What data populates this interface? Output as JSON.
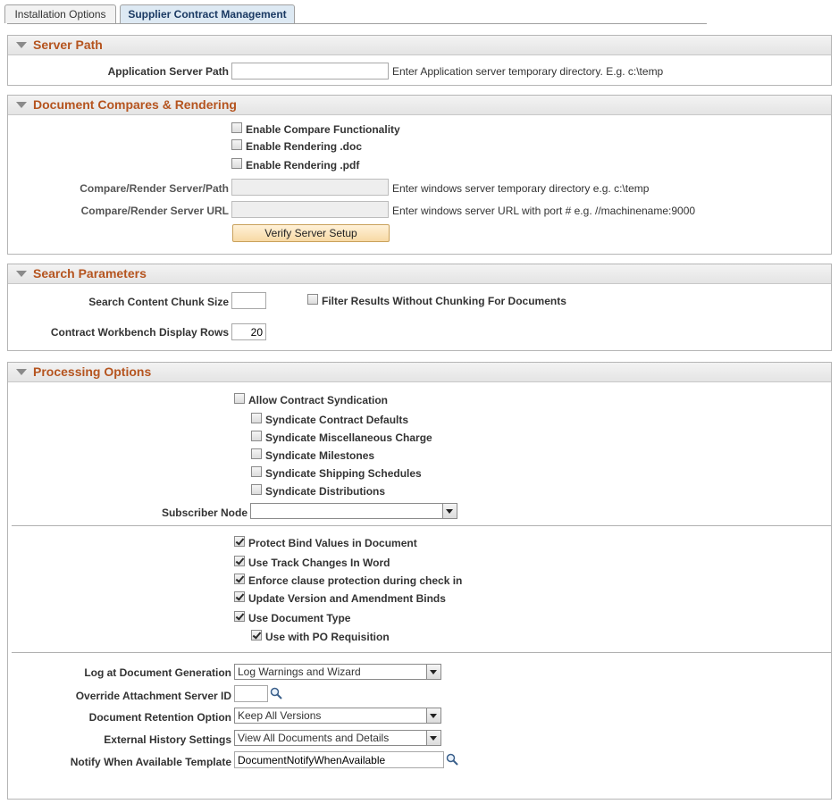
{
  "tabs": [
    {
      "label": "Installation Options"
    },
    {
      "label": "Supplier Contract Management"
    }
  ],
  "server_path": {
    "title": "Server Path",
    "app_server_path_label": "Application Server Path",
    "app_server_path_value": "",
    "app_server_path_help": "Enter Application server temporary directory. E.g. c:\\temp"
  },
  "doc_compares": {
    "title": "Document Compares & Rendering",
    "enable_compare": {
      "label": "Enable Compare Functionality",
      "checked": false
    },
    "enable_doc": {
      "label": "Enable Rendering .doc",
      "checked": false
    },
    "enable_pdf": {
      "label": "Enable Rendering .pdf",
      "checked": false
    },
    "server_path_label": "Compare/Render Server/Path",
    "server_path_value": "",
    "server_path_help": "Enter windows server temporary directory e.g. c:\\temp",
    "server_url_label": "Compare/Render Server URL",
    "server_url_value": "",
    "server_url_help": "Enter windows server URL with port # e.g. //machinename:9000",
    "verify_button": "Verify Server Setup"
  },
  "search_params": {
    "title": "Search Parameters",
    "chunk_size_label": "Search Content Chunk Size",
    "chunk_size_value": "",
    "filter_results": {
      "label": "Filter Results Without Chunking For Documents",
      "checked": false
    },
    "display_rows_label": "Contract Workbench Display Rows",
    "display_rows_value": "20"
  },
  "processing": {
    "title": "Processing Options",
    "allow_syndication": {
      "label": "Allow Contract Syndication",
      "checked": false
    },
    "syndicate_defaults": {
      "label": "Syndicate Contract Defaults",
      "checked": false
    },
    "syndicate_misc": {
      "label": "Syndicate Miscellaneous Charge",
      "checked": false
    },
    "syndicate_milestones": {
      "label": "Syndicate Milestones",
      "checked": false
    },
    "syndicate_shipping": {
      "label": "Syndicate Shipping Schedules",
      "checked": false
    },
    "syndicate_distributions": {
      "label": "Syndicate Distributions",
      "checked": false
    },
    "subscriber_node_label": "Subscriber Node",
    "subscriber_node_value": "",
    "protect_bind": {
      "label": "Protect Bind Values in Document",
      "checked": true
    },
    "track_changes": {
      "label": "Use Track Changes In Word",
      "checked": true
    },
    "enforce_clause": {
      "label": "Enforce clause protection during check in",
      "checked": true
    },
    "update_version": {
      "label": "Update Version and Amendment Binds",
      "checked": true
    },
    "use_doc_type": {
      "label": "Use Document Type",
      "checked": true
    },
    "use_po_req": {
      "label": "Use with PO Requisition",
      "checked": true
    },
    "log_label": "Log at Document Generation",
    "log_value": "Log Warnings and Wizard",
    "override_label": "Override Attachment Server ID",
    "override_value": "",
    "retention_label": "Document Retention Option",
    "retention_value": "Keep All Versions",
    "history_label": "External History Settings",
    "history_value": "View All Documents and Details",
    "notify_label": "Notify When Available Template",
    "notify_value": "DocumentNotifyWhenAvailable"
  },
  "colors": {
    "section_title": "#b5541f",
    "button_bg": "#f7d9a4"
  }
}
